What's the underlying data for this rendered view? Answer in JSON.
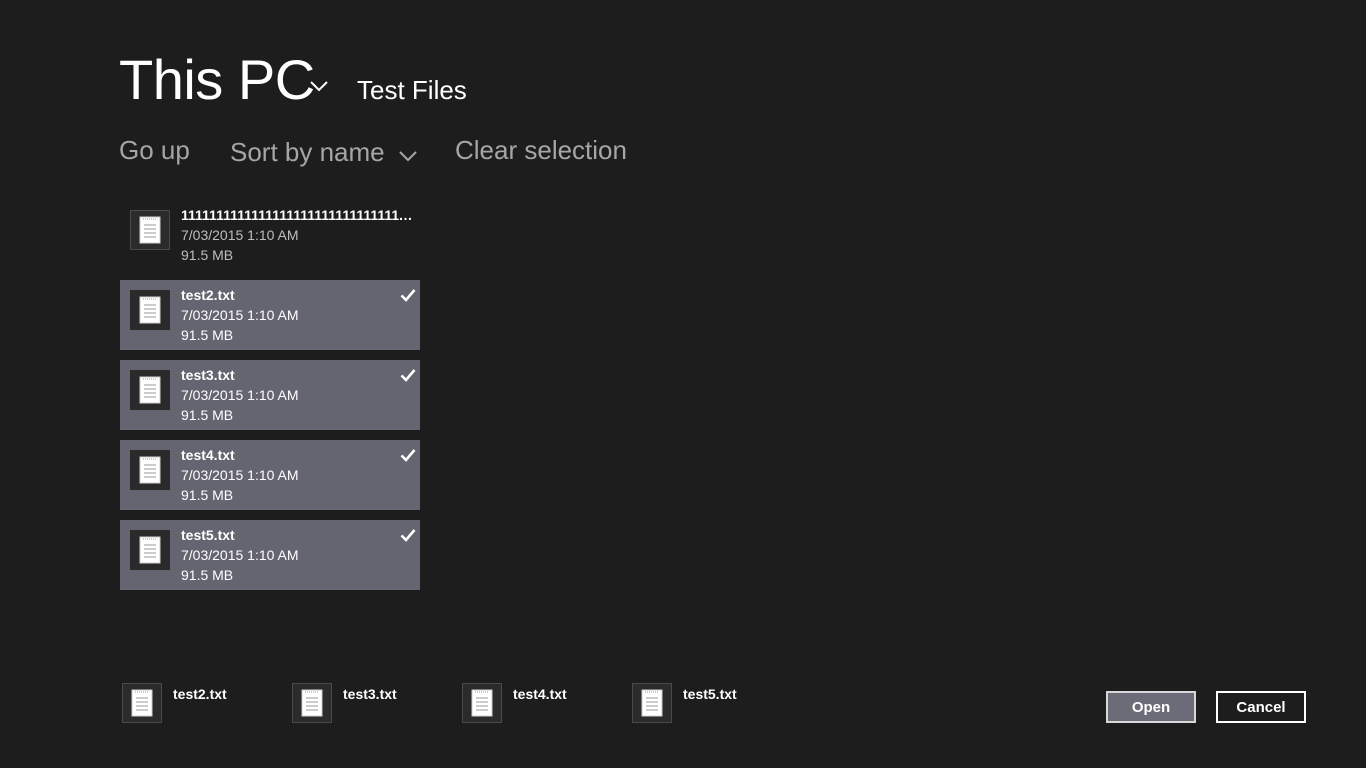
{
  "header": {
    "location": "This PC",
    "folder": "Test Files"
  },
  "commands": {
    "go_up": "Go up",
    "sort": "Sort by name",
    "clear_selection": "Clear selection"
  },
  "files": [
    {
      "name": "11111111111111111111111111111111111111...",
      "date": "7/03/2015 1:10 AM",
      "size": "91.5 MB",
      "selected": false
    },
    {
      "name": "test2.txt",
      "date": "7/03/2015 1:10 AM",
      "size": "91.5 MB",
      "selected": true
    },
    {
      "name": "test3.txt",
      "date": "7/03/2015 1:10 AM",
      "size": "91.5 MB",
      "selected": true
    },
    {
      "name": "test4.txt",
      "date": "7/03/2015 1:10 AM",
      "size": "91.5 MB",
      "selected": true
    },
    {
      "name": "test5.txt",
      "date": "7/03/2015 1:10 AM",
      "size": "91.5 MB",
      "selected": true
    }
  ],
  "basket": [
    {
      "name": "test2.txt"
    },
    {
      "name": "test3.txt"
    },
    {
      "name": "test4.txt"
    },
    {
      "name": "test5.txt"
    }
  ],
  "buttons": {
    "open": "Open",
    "cancel": "Cancel"
  },
  "colors": {
    "background": "#1d1d1d",
    "selected_item": "#646570",
    "command_text": "#a6a6a6"
  },
  "icons": {
    "file": "text-document-icon",
    "chevron": "chevron-down-icon",
    "check": "checkmark-icon"
  }
}
